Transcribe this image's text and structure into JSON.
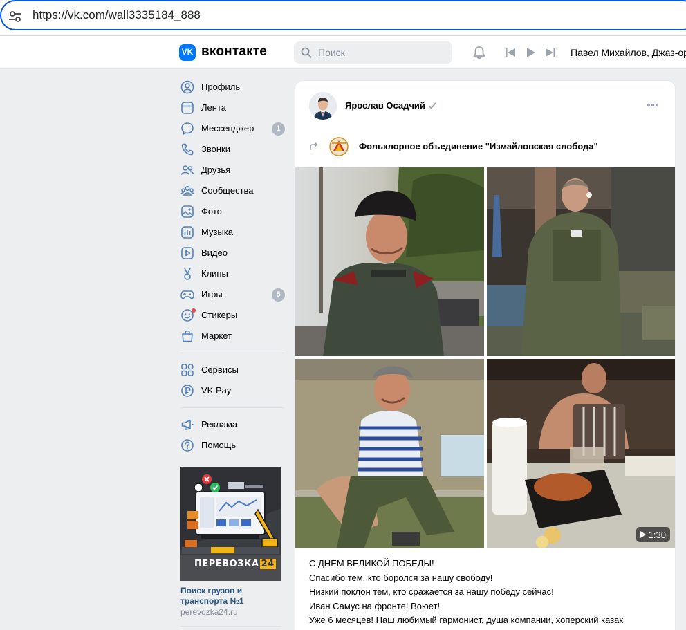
{
  "browser": {
    "url": "https://vk.com/wall3335184_888"
  },
  "header": {
    "brand": "вконтакте",
    "logo_letters": "VK",
    "search_placeholder": "Поиск",
    "now_playing": "Павел Михайлов, Джаз-ор"
  },
  "menu": {
    "items": [
      {
        "label": "Профиль",
        "icon": "profile-icon"
      },
      {
        "label": "Лента",
        "icon": "news-icon"
      },
      {
        "label": "Мессенджер",
        "icon": "message-icon",
        "badge": "1"
      },
      {
        "label": "Звонки",
        "icon": "phone-icon"
      },
      {
        "label": "Друзья",
        "icon": "friends-icon"
      },
      {
        "label": "Сообщества",
        "icon": "groups-icon"
      },
      {
        "label": "Фото",
        "icon": "photo-icon"
      },
      {
        "label": "Музыка",
        "icon": "music-icon"
      },
      {
        "label": "Видео",
        "icon": "video-icon"
      },
      {
        "label": "Клипы",
        "icon": "clips-icon"
      },
      {
        "label": "Игры",
        "icon": "games-icon",
        "badge": "5"
      },
      {
        "label": "Стикеры",
        "icon": "stickers-icon"
      },
      {
        "label": "Маркет",
        "icon": "market-icon"
      }
    ],
    "services": [
      {
        "label": "Сервисы",
        "icon": "services-icon"
      },
      {
        "label": "VK Pay",
        "icon": "vkpay-icon"
      }
    ],
    "extra": [
      {
        "label": "Реклама",
        "icon": "ads-icon"
      },
      {
        "label": "Помощь",
        "icon": "help-icon"
      }
    ]
  },
  "ad": {
    "logo_text": "ПЕРЕВОЗКА",
    "logo_number": "24",
    "title": "Поиск грузов и транспорта №1",
    "domain": "perevozka24.ru"
  },
  "post": {
    "author": "Ярослав Осадчий",
    "group": "Фольклорное объединение \"Измайловская слобода\"",
    "video_duration": "1:30",
    "text_lines": [
      "С ДНЁМ ВЕЛИКОЙ ПОБЕДЫ!",
      "Спасибо тем, кто боролся за нашу свободу!",
      "Низкий поклон тем, кто сражается за нашу победу сейчас!",
      "Иван Самус на фронте! Воюет!",
      "Уже 6 месяцев! Наш любимый гармонист, душа компании, хоперский казак"
    ]
  },
  "colors": {
    "accent": "#0077ff",
    "link": "#2a5885",
    "badge": "#aeb7c2",
    "background": "#edeef0"
  }
}
